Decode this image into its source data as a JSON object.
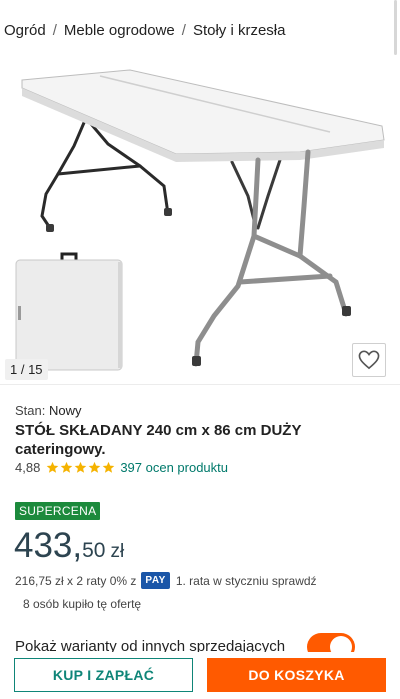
{
  "breadcrumb": {
    "items": [
      "Ogród",
      "Meble ogrodowe",
      "Stoły i krzesła"
    ],
    "separator": "/"
  },
  "gallery": {
    "counter": "1 / 15",
    "favorite_icon": "heart-icon"
  },
  "product": {
    "condition_label": "Stan:",
    "condition_value": "Nowy",
    "title": "STÓŁ SKŁADANY 240 cm x 86 cm DUŻY cateringowy.",
    "rating_value": "4,88",
    "stars": 5,
    "reviews_text": "397 ocen produktu"
  },
  "pricing": {
    "badge": "SUPERCENA",
    "price_int": "433,",
    "price_cents": "50",
    "currency": "zł",
    "installments_text": "216,75 zł x 2 raty 0% z",
    "pay_badge": "PAY",
    "installments_suffix": "1. rata w styczniu sprawdź",
    "bought_text": "8 osób kupiło tę ofertę"
  },
  "variants": {
    "label": "Pokaż warianty od innych sprzedających",
    "toggle_on": true
  },
  "actions": {
    "buy_now": "KUP I ZAPŁAĆ",
    "add_to_cart": "DO KOSZYKA"
  },
  "colors": {
    "accent_orange": "#ff5a00",
    "teal": "#0f8578",
    "supercena_green": "#1c8a3c",
    "star_gold": "#f5b301",
    "pay_blue": "#1a56a8"
  }
}
